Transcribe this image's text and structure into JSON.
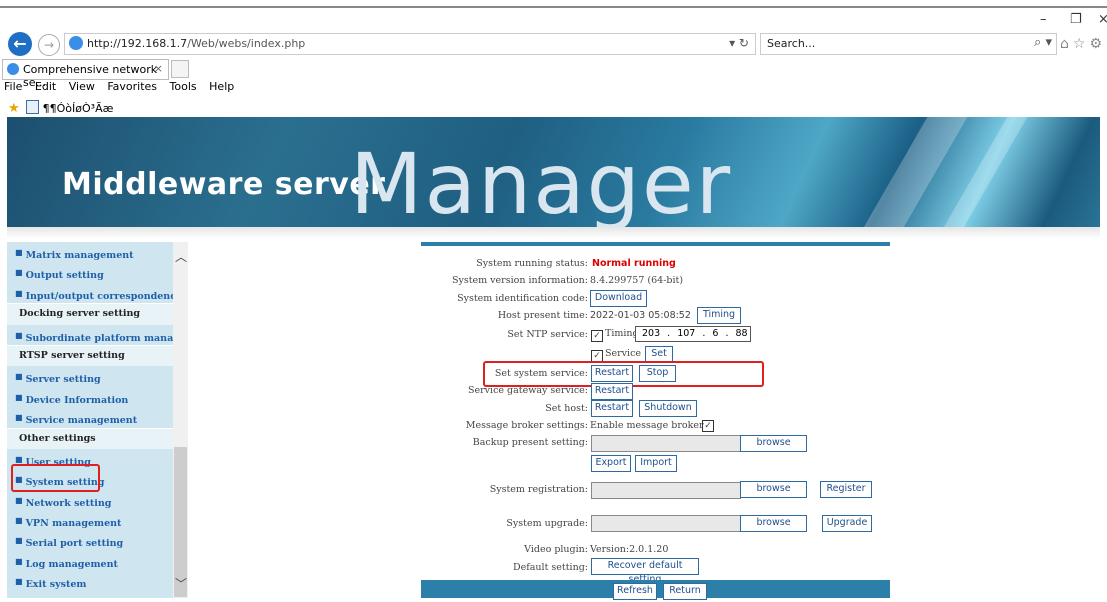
{
  "browser": {
    "url_host": "http://192.168.1.7",
    "url_path": "/Web/webs/index.php",
    "search_placeholder": "Search...",
    "tab_title": "Comprehensive network se...",
    "menu": [
      "File",
      "Edit",
      "View",
      "Favorites",
      "Tools",
      "Help"
    ],
    "favorite_label": "¶¶ÓòÍøÒ³Ãæ"
  },
  "banner": {
    "title_small": "Middleware server",
    "title_large": "Manager"
  },
  "sidebar": {
    "items": [
      {
        "label": "Matrix management",
        "type": "item"
      },
      {
        "label": "Output setting",
        "type": "item"
      },
      {
        "label": "Input/output correspondence",
        "type": "item"
      },
      {
        "label": "Docking server setting",
        "type": "head"
      },
      {
        "label": "Subordinate platform management",
        "type": "item"
      },
      {
        "label": "RTSP server setting",
        "type": "head"
      },
      {
        "label": "Server setting",
        "type": "item"
      },
      {
        "label": "Device Information",
        "type": "item"
      },
      {
        "label": "Service management",
        "type": "item"
      },
      {
        "label": "Other settings",
        "type": "head"
      },
      {
        "label": "User setting",
        "type": "item"
      },
      {
        "label": "System setting",
        "type": "item"
      },
      {
        "label": "Network setting",
        "type": "item"
      },
      {
        "label": "VPN management",
        "type": "item"
      },
      {
        "label": "Serial port setting",
        "type": "item"
      },
      {
        "label": "Log management",
        "type": "item"
      },
      {
        "label": "Exit system",
        "type": "item"
      }
    ]
  },
  "panel": {
    "status_label": "System running status:",
    "status_value": "Normal running",
    "version_label": "System version information:",
    "version_value": "8.4.299757 (64-bit)",
    "idcode_label": "System identification code:",
    "download_btn": "Download",
    "time_label": "Host present time:",
    "time_value": "2022-01-03 05:08:52",
    "timing_btn": "Timing",
    "ntp_label": "Set NTP service:",
    "ntp_timing_label": "Timing",
    "ntp_ip": "203 . 107 .  6  . 88",
    "ntp_service_label": "Service",
    "ntp_set_btn": "Set",
    "syssvc_label": "Set system service:",
    "restart_btn": "Restart",
    "stop_btn": "Stop",
    "gateway_label": "Service gateway service:",
    "gateway_restart_btn": "Restart",
    "host_label": "Set host:",
    "host_restart_btn": "Restart",
    "shutdown_btn": "Shutdown",
    "broker_label": "Message broker settings:",
    "broker_value": "Enable message broker",
    "backup_label": "Backup present setting:",
    "browse_btn": "browse",
    "export_btn": "Export",
    "import_btn": "Import",
    "registration_label": "System registration:",
    "register_btn": "Register",
    "upgrade_label": "System upgrade:",
    "upgrade_btn": "Upgrade",
    "plugin_label": "Video plugin:",
    "plugin_value": "Version:2.0.1.20",
    "default_label": "Default setting:",
    "recover_btn": "Recover default setting",
    "refresh_btn": "Refresh",
    "return_btn": "Return"
  }
}
